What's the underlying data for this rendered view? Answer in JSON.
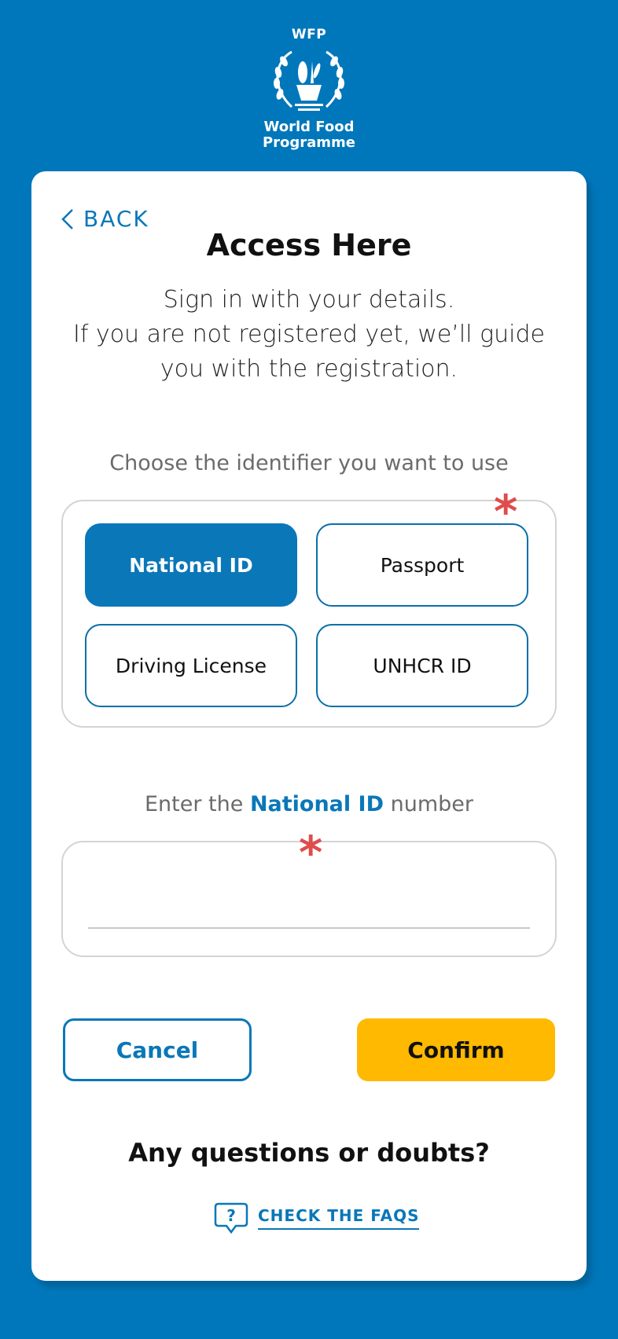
{
  "header": {
    "logo_abbr": "WFP",
    "logo_line1": "World Food",
    "logo_line2": "Programme"
  },
  "nav": {
    "back_label": "BACK"
  },
  "page": {
    "title": "Access Here",
    "subtitle_line1": "Sign in with your details.",
    "subtitle_line2": "If you are not registered yet, we’ll guide",
    "subtitle_line3": "you with the registration."
  },
  "identifier": {
    "prompt": "Choose the identifier you want to use",
    "required_mark": "*",
    "options": [
      {
        "label": "National ID",
        "selected": true
      },
      {
        "label": "Passport",
        "selected": false
      },
      {
        "label": "Driving License",
        "selected": false
      },
      {
        "label": "UNHCR ID",
        "selected": false
      }
    ]
  },
  "number_input": {
    "label_prefix": "Enter the",
    "label_highlight": "National ID",
    "label_suffix": "number",
    "required_mark": "*",
    "value": "",
    "placeholder": ""
  },
  "actions": {
    "cancel_label": "Cancel",
    "confirm_label": "Confirm"
  },
  "help": {
    "question": "Any questions or doubts?",
    "faq_label": "CHECK THE FAQS"
  },
  "colors": {
    "brand_blue": "#0077bb",
    "accent_yellow": "#ffb900",
    "required_red": "#e04c4c"
  }
}
